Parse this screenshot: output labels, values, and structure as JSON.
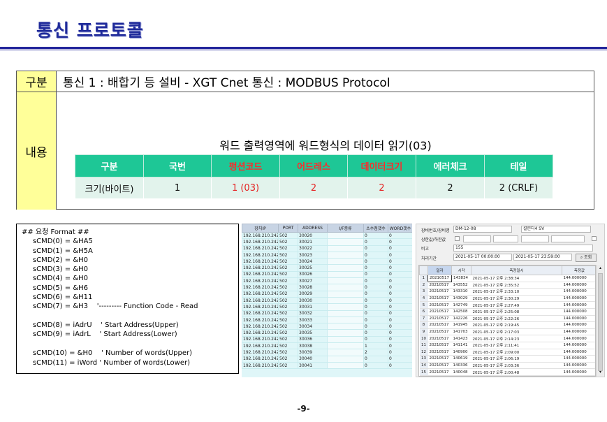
{
  "title": "통신 프로토콜",
  "summary": {
    "header_label": "구분",
    "header_text": "통신 1 : 배합기 등 설비 - XGT Cnet 통신 : MODBUS Protocol",
    "content_label": "내용",
    "content_heading": "워드 출력영역에 워드형식의 데이터 읽기(03)",
    "table": {
      "headers": [
        "구분",
        "국번",
        "펑션코드",
        "어드레스",
        "데이터크기",
        "에러체크",
        "테일"
      ],
      "row": [
        "크기(바이트)",
        "1",
        "1 (03)",
        "2",
        "2",
        "2",
        "2 (CRLF)"
      ],
      "highlight_color": "#e52222",
      "header_color": "#1ec796"
    }
  },
  "code": {
    "lines": [
      "## 요청 Format ##",
      "     sCMD(0) = &HA5",
      "     sCMD(1) = &H5A",
      "     sCMD(2) = &H0",
      "     sCMD(3) = &H0",
      "     sCMD(4) = &H0",
      "     sCMD(5) = &H6",
      "     sCMD(6) = &H11",
      "     sCMD(7) = &H3    '--------- Function Code - Read",
      "",
      "     sCMD(8) = iAdrU    ' Start Address(Upper)",
      "     sCMD(9) = iAdrL    ' Start Address(Lower)",
      "",
      "     sCMD(10) = &H0    ' Number of words(Upper)",
      "     sCMD(11) = iWord ' Number of words(Lower)"
    ]
  },
  "grid1": {
    "headers": [
      "장치IP",
      "PORT",
      "ADDRESS",
      "I/F종류",
      "소수점갯수",
      "WORD갯수"
    ],
    "rows": [
      [
        "192.168.210.242",
        "502",
        "30020",
        "",
        "0",
        "0"
      ],
      [
        "192.168.210.242",
        "502",
        "30021",
        "",
        "0",
        "0"
      ],
      [
        "192.168.210.242",
        "502",
        "30022",
        "",
        "0",
        "0"
      ],
      [
        "192.168.210.242",
        "502",
        "30023",
        "",
        "0",
        "0"
      ],
      [
        "192.168.210.242",
        "502",
        "30024",
        "",
        "0",
        "0"
      ],
      [
        "192.168.210.242",
        "502",
        "30025",
        "",
        "0",
        "0"
      ],
      [
        "192.168.210.242",
        "502",
        "30026",
        "",
        "0",
        "0"
      ],
      [
        "192.168.210.242",
        "502",
        "30027",
        "",
        "0",
        "0"
      ],
      [
        "192.168.210.242",
        "502",
        "30028",
        "",
        "0",
        "0"
      ],
      [
        "192.168.210.242",
        "502",
        "30029",
        "",
        "0",
        "0"
      ],
      [
        "192.168.210.242",
        "502",
        "30030",
        "",
        "0",
        "0"
      ],
      [
        "192.168.210.242",
        "502",
        "30031",
        "",
        "0",
        "0"
      ],
      [
        "192.168.210.242",
        "502",
        "30032",
        "",
        "0",
        "0"
      ],
      [
        "192.168.210.242",
        "502",
        "30033",
        "",
        "0",
        "0"
      ],
      [
        "192.168.210.242",
        "502",
        "30034",
        "",
        "0",
        "0"
      ],
      [
        "192.168.210.242",
        "502",
        "30035",
        "",
        "0",
        "0"
      ],
      [
        "192.168.210.242",
        "502",
        "30036",
        "",
        "0",
        "0"
      ],
      [
        "192.168.210.242",
        "502",
        "30038",
        "",
        "1",
        "0"
      ],
      [
        "192.168.210.242",
        "502",
        "30039",
        "",
        "2",
        "0"
      ],
      [
        "192.168.210.242",
        "502",
        "30040",
        "",
        "0",
        "0"
      ],
      [
        "192.168.210.242",
        "502",
        "30041",
        "",
        "0",
        "0"
      ]
    ]
  },
  "panel2": {
    "device_label": "장비번호/장비명",
    "device_id": "DM-12-08",
    "device_name": "설린디4 SV",
    "limit_label": "상한값/하한값",
    "note_label": "비고",
    "note_value": "155",
    "period_label": "처리기간",
    "period_start": "2021-05-17 00:00:00",
    "period_end": "2021-05-17 23:59:00",
    "search_label": "조회",
    "headers": [
      "일자",
      "시각",
      "측정일시",
      "측정값"
    ],
    "rows": [
      [
        "1",
        "20210517",
        "143834",
        "2021-05-17 오후 2:38:34",
        "144.000000"
      ],
      [
        "2",
        "20210517",
        "143552",
        "2021-05-17 오후 2:35:52",
        "144.000000"
      ],
      [
        "3",
        "20210517",
        "143310",
        "2021-05-17 오후 2:33:10",
        "144.000000"
      ],
      [
        "4",
        "20210517",
        "143029",
        "2021-05-17 오후 2:30:29",
        "144.000000"
      ],
      [
        "5",
        "20210517",
        "142749",
        "2021-05-17 오후 2:27:49",
        "144.000000"
      ],
      [
        "6",
        "20210517",
        "142508",
        "2021-05-17 오후 2:25:08",
        "144.000000"
      ],
      [
        "7",
        "20210517",
        "142226",
        "2021-05-17 오후 2:22:26",
        "144.000000"
      ],
      [
        "8",
        "20210517",
        "141945",
        "2021-05-17 오후 2:19:45",
        "144.000000"
      ],
      [
        "9",
        "20210517",
        "141703",
        "2021-05-17 오후 2:17:03",
        "144.000000"
      ],
      [
        "10",
        "20210517",
        "141423",
        "2021-05-17 오후 2:14:23",
        "144.000000"
      ],
      [
        "11",
        "20210517",
        "141141",
        "2021-05-17 오후 2:11:41",
        "144.000000"
      ],
      [
        "12",
        "20210517",
        "140900",
        "2021-05-17 오후 2:09:00",
        "144.000000"
      ],
      [
        "13",
        "20210517",
        "140619",
        "2021-05-17 오후 2:06:19",
        "144.000000"
      ],
      [
        "14",
        "20210517",
        "140336",
        "2021-05-17 오후 2:03:36",
        "144.000000"
      ],
      [
        "15",
        "20210517",
        "140048",
        "2021-05-17 오후 2:00:48",
        "144.000000"
      ]
    ]
  },
  "page_number": "-9-"
}
